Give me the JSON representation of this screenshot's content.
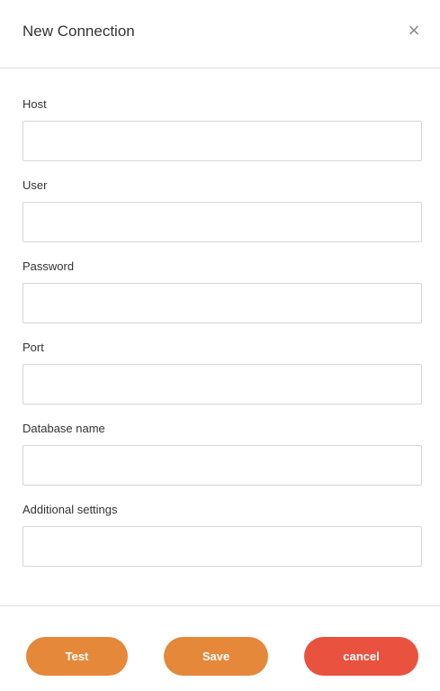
{
  "dialog": {
    "title": "New Connection",
    "close_symbol": "×"
  },
  "fields": [
    {
      "label": "Host",
      "value": "",
      "placeholder": ""
    },
    {
      "label": "User",
      "value": "",
      "placeholder": ""
    },
    {
      "label": "Password",
      "value": "",
      "placeholder": ""
    },
    {
      "label": "Port",
      "value": "",
      "placeholder": ""
    },
    {
      "label": "Database name",
      "value": "",
      "placeholder": ""
    },
    {
      "label": "Additional settings",
      "value": "",
      "placeholder": ""
    }
  ],
  "buttons": {
    "test_label": "Test",
    "save_label": "Save",
    "cancel_label": "cancel"
  },
  "colors": {
    "primary": "#E5883A",
    "danger": "#E8523F"
  },
  "icons": {
    "close": "close-icon"
  }
}
